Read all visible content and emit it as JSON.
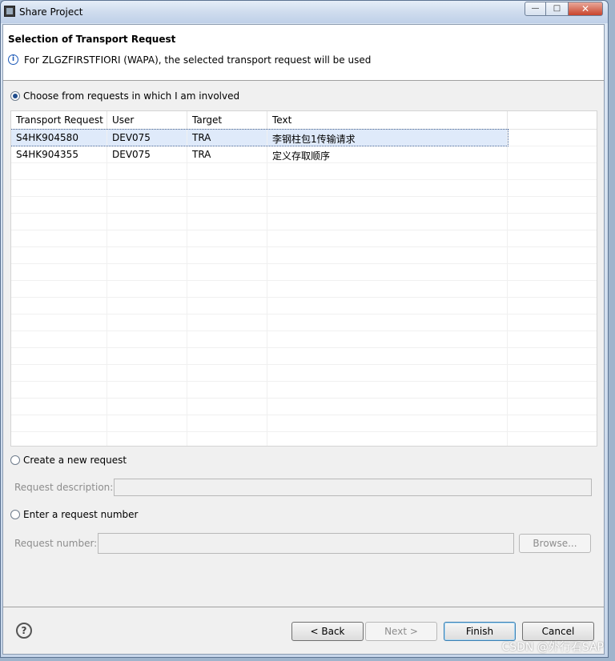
{
  "window": {
    "title": "Share Project"
  },
  "header": {
    "title": "Selection of Transport Request",
    "message": "For ZLGZFIRSTFIORI (WAPA), the selected transport request will be used"
  },
  "options": {
    "choose_label": "Choose from requests in which I am involved",
    "create_label": "Create a new request",
    "enter_label": "Enter a request number"
  },
  "table": {
    "columns": [
      "Transport Request",
      "User",
      "Target",
      "Text"
    ],
    "rows": [
      [
        "S4HK904580",
        "DEV075",
        "TRA",
        "李钢柱包1传输请求"
      ],
      [
        "S4HK904355",
        "DEV075",
        "TRA",
        "定义存取顺序"
      ]
    ]
  },
  "fields": {
    "description_label": "Request description:",
    "description_value": "",
    "number_label": "Request number:",
    "number_value": ""
  },
  "buttons": {
    "browse": "Browse...",
    "back": "< Back",
    "next": "Next >",
    "finish": "Finish",
    "cancel": "Cancel"
  },
  "watermark": "CSDN @外行看SAP"
}
